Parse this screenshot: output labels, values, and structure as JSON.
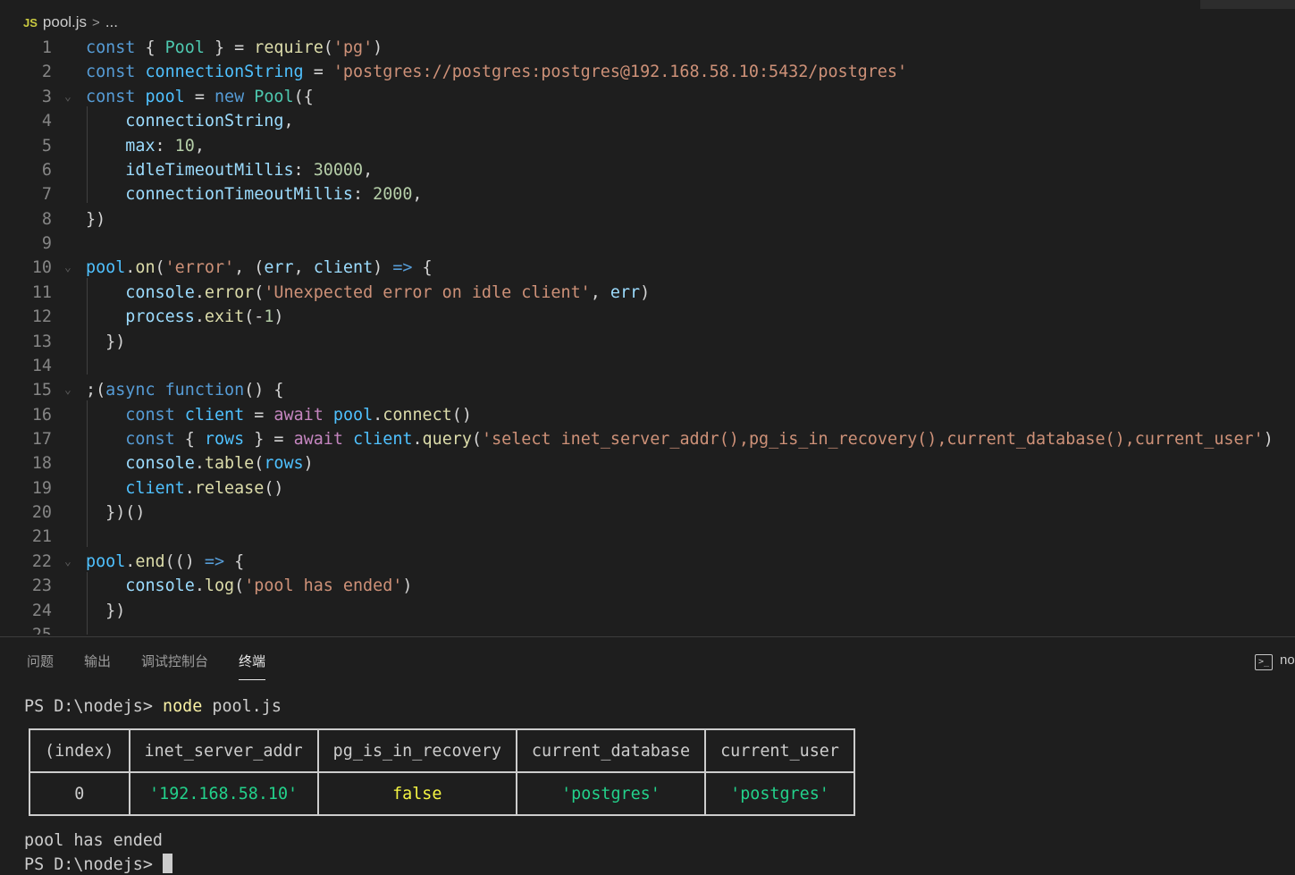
{
  "editor": {
    "breadcrumb": {
      "icon": "JS",
      "file": "pool.js",
      "separator": ">",
      "more": "..."
    },
    "line_numbers": [
      "1",
      "2",
      "3",
      "4",
      "5",
      "6",
      "7",
      "8",
      "9",
      "10",
      "11",
      "12",
      "13",
      "14",
      "15",
      "16",
      "17",
      "18",
      "19",
      "20",
      "21",
      "22",
      "23",
      "24",
      "25"
    ]
  },
  "panel": {
    "tabs": [
      "问题",
      "输出",
      "调试控制台",
      "终端"
    ],
    "active_tab": "终端",
    "terminal_name": "no",
    "terminal": {
      "prompt1": "PS D:\\nodejs>",
      "cmd_name": "node",
      "cmd_args": "pool.js",
      "table": {
        "headers": [
          "(index)",
          "inet_server_addr",
          "pg_is_in_recovery",
          "current_database",
          "current_user"
        ],
        "row": [
          "0",
          "'192.168.58.10'",
          "false",
          "'postgres'",
          "'postgres'"
        ]
      },
      "output_line": "pool has ended",
      "prompt2": "PS D:\\nodejs>"
    }
  }
}
